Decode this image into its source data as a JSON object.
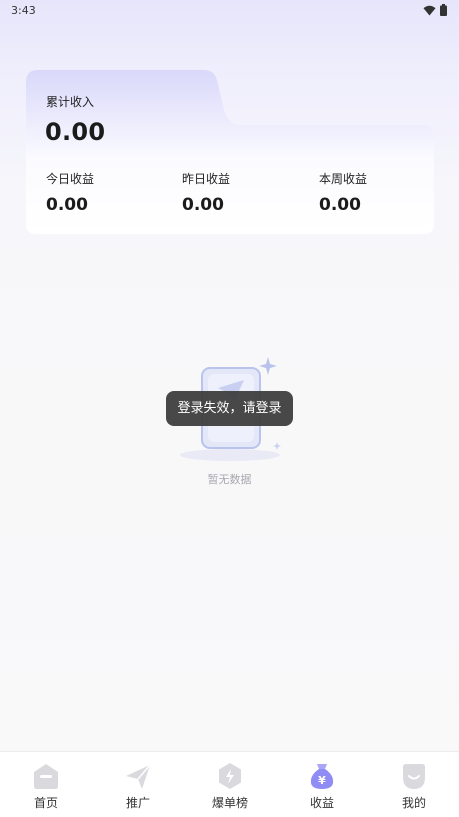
{
  "status_bar": {
    "time": "3:43"
  },
  "summary": {
    "total_label": "累计收入",
    "total_value": "0.00",
    "stats": [
      {
        "label": "今日收益",
        "value": "0.00"
      },
      {
        "label": "昨日收益",
        "value": "0.00"
      },
      {
        "label": "本周收益",
        "value": "0.00"
      }
    ]
  },
  "empty_state": {
    "text": "暂无数据"
  },
  "toast": {
    "message": "登录失效，请登录"
  },
  "bottom_nav": {
    "items": [
      {
        "label": "首页",
        "icon": "home-icon"
      },
      {
        "label": "推广",
        "icon": "paper-plane-icon"
      },
      {
        "label": "爆单榜",
        "icon": "bolt-icon"
      },
      {
        "label": "收益",
        "icon": "money-bag-icon",
        "active": true
      },
      {
        "label": "我的",
        "icon": "profile-icon"
      }
    ]
  },
  "colors": {
    "accent": "#8f8cf5",
    "inactive_icon": "#d9d9de",
    "toast_bg": "#3e3e3e"
  }
}
